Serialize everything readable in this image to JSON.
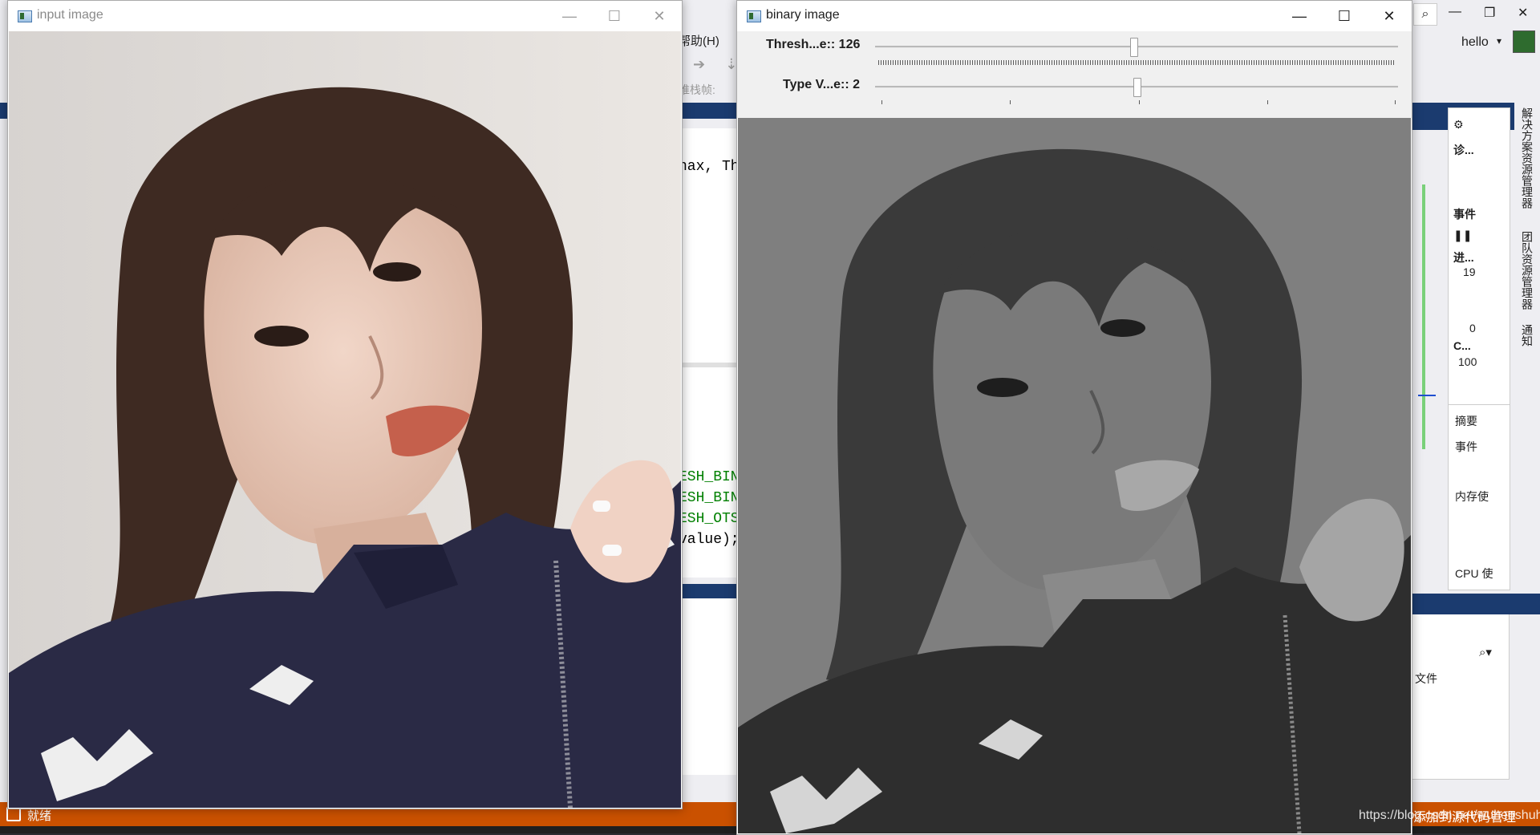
{
  "background_ide": {
    "menu_help": "帮助(H)",
    "stack_frame_label": "堆栈帧:",
    "code_lines": [
      "nax,  Thi",
      "ESH_BIN.",
      "ESH_BIN.",
      "ESH_OTSU",
      "value);"
    ],
    "status_ready": "就绪",
    "source_control": "添加到源代码管理",
    "user_name": "hello",
    "diagnostics": {
      "title_short": "诊...",
      "events_header": "事件",
      "process_header": "进...",
      "process_values": [
        "19",
        "0"
      ],
      "cpu_header": "C...",
      "cpu_value": "100",
      "summary_tab": "摘要",
      "summary_events": "事件",
      "memory_usage": "内存使",
      "cpu_usage": "CPU 使"
    },
    "right_vertical_tabs": [
      "解决方案资源管理器",
      "团队资源管理器",
      "通知"
    ],
    "file_label": "文件"
  },
  "input_window": {
    "title": "input image",
    "minimize": "—",
    "maximize": "☐",
    "close": "✕"
  },
  "binary_window": {
    "title": "binary image",
    "minimize": "—",
    "maximize": "☐",
    "close": "✕",
    "trackbars": [
      {
        "label": "Thresh...e:: 126",
        "value": 126,
        "max": 255
      },
      {
        "label": "Type V...e:: 2",
        "value": 2,
        "max": 4
      }
    ]
  },
  "watermark": "https://blog.csdn.net/wuhenshuhe",
  "colors": {
    "vs_status_orange": "#ca5100",
    "vs_navy": "#1b3b6f",
    "binary_gray": "#7f7f7f"
  }
}
